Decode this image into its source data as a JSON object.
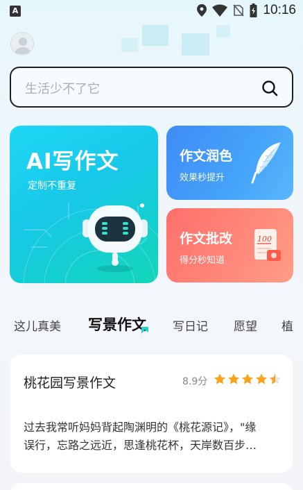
{
  "status_bar": {
    "app_icon_letter": "A",
    "time": "10:16",
    "icons": [
      "location-icon",
      "wifi-icon",
      "no-sim-icon",
      "battery-icon"
    ]
  },
  "search": {
    "placeholder": "生活少不了它"
  },
  "features": {
    "ai_write": {
      "title": "AI写作文",
      "subtitle": "定制不重复"
    },
    "polish": {
      "title": "作文润色",
      "subtitle": "效果秒提升"
    },
    "grade": {
      "title": "作文批改",
      "subtitle": "得分秒知道",
      "icon_text": "100"
    }
  },
  "tabs": [
    {
      "label": "这儿真美",
      "active": false
    },
    {
      "label": "写景作文",
      "active": true
    },
    {
      "label": "写日记",
      "active": false
    },
    {
      "label": "愿望",
      "active": false
    },
    {
      "label": "植",
      "active": false
    }
  ],
  "essay": {
    "title": "桃花园写景作文",
    "score": "8.9分",
    "rating": 4.5,
    "excerpt_line1": "过去我常听妈妈背起陶渊明的《桃花源记》，\"缘",
    "excerpt_line2": "误行，忘路之远近，思逢桃花杯，天岸数百步…"
  },
  "colors": {
    "ai_card": "#1fd7f6",
    "polish_card": "#3f8cf6",
    "grade_card": "#ff6f6b",
    "star": "#f9a21a"
  }
}
